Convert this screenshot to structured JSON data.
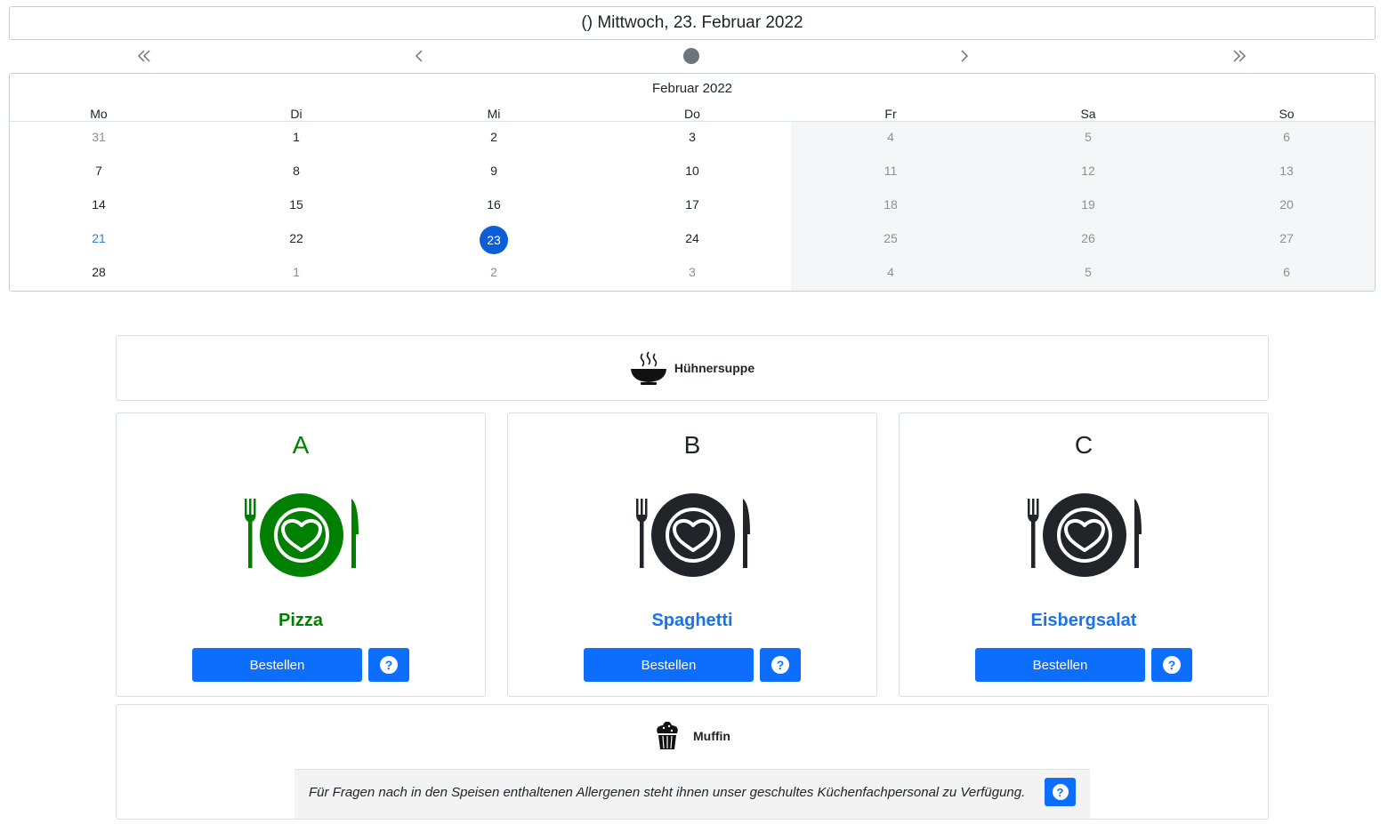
{
  "header": {
    "date_text": "() Mittwoch, 23. Februar 2022"
  },
  "nav": {
    "first_icon": "double-chevron-left-icon",
    "prev_icon": "chevron-left-icon",
    "today_icon": "dot-icon",
    "next_icon": "chevron-right-icon",
    "last_icon": "double-chevron-right-icon"
  },
  "calendar": {
    "month_title": "Februar 2022",
    "weekdays": [
      "Mo",
      "Di",
      "Mi",
      "Do",
      "Fr",
      "Sa",
      "So"
    ],
    "weeks": [
      [
        "31",
        "1",
        "2",
        "3",
        "4",
        "5",
        "6"
      ],
      [
        "7",
        "8",
        "9",
        "10",
        "11",
        "12",
        "13"
      ],
      [
        "14",
        "15",
        "16",
        "17",
        "18",
        "19",
        "20"
      ],
      [
        "21",
        "22",
        "23",
        "24",
        "25",
        "26",
        "27"
      ],
      [
        "28",
        "1",
        "2",
        "3",
        "4",
        "5",
        "6"
      ]
    ],
    "selected_day": "23",
    "today_day": "21",
    "colors": {
      "selected": "#0b5ed7",
      "today": "#3a7dc9",
      "muted": "#8a9096",
      "weekend_bg": "#f5f6f7"
    }
  },
  "soup": {
    "name": "Hühnersuppe",
    "icon": "soup-bowl-icon"
  },
  "meals": [
    {
      "letter": "A",
      "name": "Pizza",
      "order_label": "Bestellen",
      "help_label": "?",
      "selected": true,
      "color": "#008000",
      "name_color": "#008000",
      "icon": "plate-heart-icon"
    },
    {
      "letter": "B",
      "name": "Spaghetti",
      "order_label": "Bestellen",
      "help_label": "?",
      "selected": false,
      "color": "#212529",
      "name_color": "#1a73e8",
      "icon": "plate-heart-icon"
    },
    {
      "letter": "C",
      "name": "Eisbergsalat",
      "order_label": "Bestellen",
      "help_label": "?",
      "selected": false,
      "color": "#212529",
      "name_color": "#1a73e8",
      "icon": "plate-heart-icon"
    }
  ],
  "dessert": {
    "name": "Muffin",
    "icon": "muffin-icon"
  },
  "allergen": {
    "text": "Für Fragen nach in den Speisen enthaltenen Allergenen steht ihnen unser geschultes Küchenfachpersonal zu Verfügung.",
    "help_label": "?"
  }
}
